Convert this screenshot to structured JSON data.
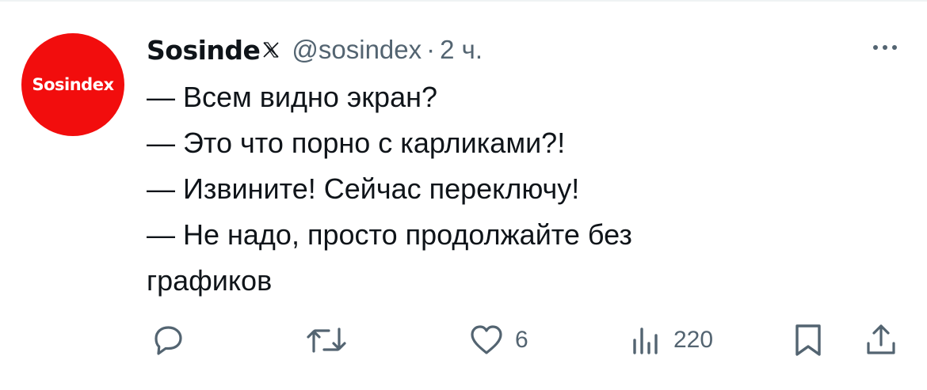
{
  "tweet": {
    "avatar_text": "Sosindex",
    "author_name": "Sosinde",
    "handle": "@sosindex",
    "separator": "·",
    "time": "2 ч.",
    "lines": [
      "— Всем видно экран?",
      "— Это что порно с карликами?!",
      "— Извините! Сейчас переключу!",
      "— Не надо, просто продолжайте без",
      "графиков"
    ]
  },
  "actions": {
    "likes": "6",
    "views": "220"
  },
  "icons": {
    "verified": "x-logo-icon",
    "more": "more-icon",
    "reply": "reply-icon",
    "retweet": "retweet-icon",
    "like": "heart-icon",
    "views": "views-icon",
    "bookmark": "bookmark-icon",
    "share": "share-icon"
  },
  "colors": {
    "avatar_bg": "#f20d0d",
    "text_primary": "#0f1419",
    "text_secondary": "#536471"
  }
}
